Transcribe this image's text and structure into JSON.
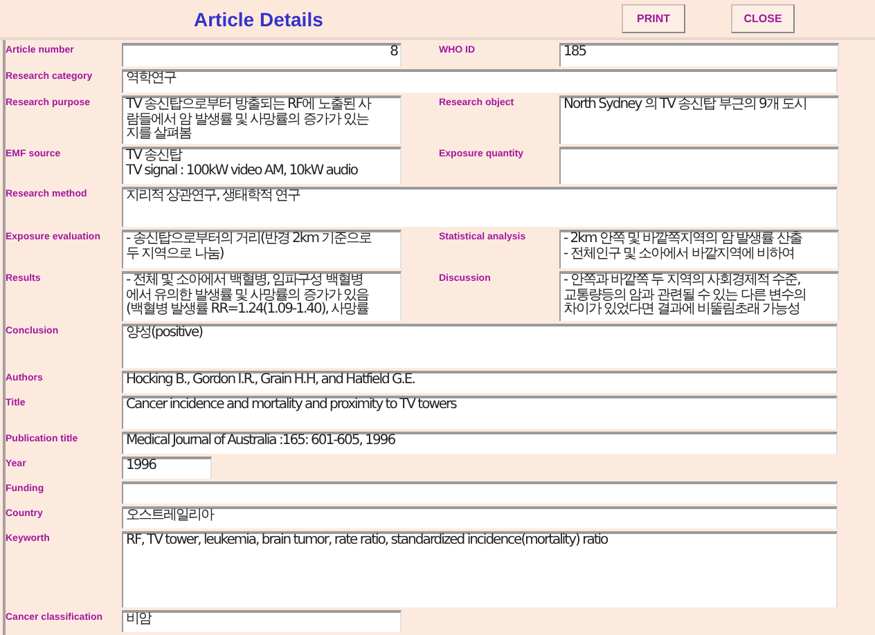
{
  "header": {
    "title": "Article Details",
    "buttons": [
      "PRINT",
      "CLOSE"
    ]
  },
  "rows": [
    {
      "kind": "pair",
      "fields": [
        {
          "label": "Article number",
          "value": "8",
          "kind": "number"
        },
        {
          "label": "WHO ID",
          "value": "185",
          "kind": "text"
        }
      ]
    },
    {
      "kind": "full",
      "fields": [
        {
          "label": "Research category",
          "value": "역학연구",
          "kind": "text"
        }
      ]
    },
    {
      "kind": "pair",
      "fields": [
        {
          "label": "Research purpose",
          "value": "TV 송신탑으로부터 방출되는 RF에 노출된 사\n람들에서 암 발생률 및 사망률의 증가가 있는\n지를 살펴봄",
          "kind": "text"
        },
        {
          "label": "Research object",
          "value": "North Sydney 의 TV 송신탑 부근의 9개 도시",
          "kind": "text"
        }
      ]
    },
    {
      "kind": "pair",
      "fields": [
        {
          "label": "EMF source",
          "value": "TV 송신탑\nTV signal : 100kW video AM, 10kW audio",
          "kind": "text"
        },
        {
          "label": "Exposure quantity",
          "kind": "text"
        }
      ]
    },
    {
      "kind": "full",
      "fields": [
        {
          "label": "Research method",
          "value": "지리적 상관연구, 생태학적 연구",
          "kind": "text"
        }
      ]
    },
    {
      "kind": "pair",
      "fields": [
        {
          "label": "Exposure evaluation",
          "value": "- 송신탑으로부터의 거리(반경 2km 기준으로\n두 지역으로 나눔)",
          "kind": "text"
        },
        {
          "label": "Statistical analysis",
          "value": "- 2km 안쪽 및 바깥쪽지역의 암 발생률 산출\n- 전체인구 및 소아에서 바깥지역에 비하여",
          "kind": "text"
        }
      ]
    },
    {
      "kind": "pair",
      "fields": [
        {
          "label": "Results",
          "value": "- 전체 및 소아에서 백혈병, 임파구성 백혈병\n에서 유의한 발생률 및 사망률의 증가가 있음\n(백혈병 발생률 RR=1.24(1.09-1.40), 사망률",
          "kind": "text"
        },
        {
          "label": "Discussion",
          "value": "- 안쪽과 바깥쪽 두 지역의 사회경제적 수준,\n교통량등의 암과 관련될 수 있는 다른 변수의\n차이가 있었다면 결과에 비뚤림초래 가능성",
          "kind": "text"
        }
      ]
    },
    {
      "kind": "full",
      "fields": [
        {
          "label": "Conclusion",
          "value": "양성(positive)",
          "kind": "text"
        }
      ]
    },
    {
      "kind": "full",
      "fields": [
        {
          "label": "Authors",
          "value": "Hocking B., Gordon I.R., Grain H.H, and Hatfield G.E.",
          "kind": "text"
        }
      ]
    },
    {
      "kind": "full",
      "fields": [
        {
          "label": "Title",
          "value": "Cancer incidence and mortality and proximity to TV towers",
          "kind": "text"
        }
      ]
    },
    {
      "kind": "full",
      "fields": [
        {
          "label": "Publication title",
          "value": "Medical Journal of Australia :165: 601-605, 1996",
          "kind": "text"
        }
      ]
    },
    {
      "kind": "short",
      "fields": [
        {
          "label": "Year",
          "value": "1996",
          "kind": "text"
        }
      ]
    },
    {
      "kind": "full",
      "fields": [
        {
          "label": "Funding",
          "kind": "text"
        }
      ]
    },
    {
      "kind": "full",
      "fields": [
        {
          "label": "Country",
          "value": "오스트레일리아",
          "kind": "text"
        }
      ]
    },
    {
      "kind": "full",
      "fields": [
        {
          "label": "Keyworth",
          "value": "RF, TV tower, leukemia, brain tumor, rate ratio, standardized incidence(mortality) ratio",
          "kind": "text"
        }
      ]
    },
    {
      "kind": "half",
      "fields": [
        {
          "label": "Cancer classification",
          "value": "비암",
          "kind": "text"
        }
      ]
    }
  ]
}
